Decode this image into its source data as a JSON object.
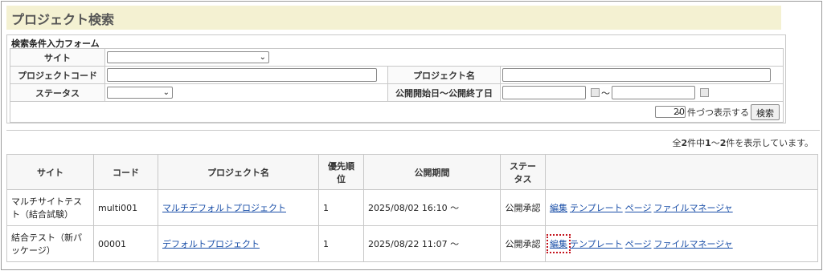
{
  "page_title": "プロジェクト検索",
  "form": {
    "caption": "検索条件入力フォーム",
    "site_label": "サイト",
    "site_value": "",
    "code_label": "プロジェクトコード",
    "code_value": "",
    "name_label": "プロジェクト名",
    "name_value": "",
    "status_label": "ステータス",
    "status_value": "",
    "period_label": "公開開始日～公開終了日",
    "period_start": "",
    "period_end": "",
    "tilde": "～",
    "per_page_value": "20",
    "per_page_label": "件づつ表示する",
    "search_button": "検索"
  },
  "count": {
    "prefix": "全",
    "total": "2",
    "mid1": "件中",
    "from": "1",
    "sep": "～",
    "to": "2",
    "suffix": "件を表示しています。"
  },
  "table": {
    "headers": [
      "サイト",
      "コード",
      "プロジェクト名",
      "優先順\n位",
      "公開期間",
      "ステー\nタス",
      ""
    ],
    "rows": [
      {
        "site": "マルチサイトテスト（結合試験）",
        "code": "multi001",
        "name": "マルチデフォルトプロジェクト",
        "priority": "1",
        "period": "2025/08/02 16:10 ～",
        "status": "公開承認",
        "actions": [
          "編集",
          "テンプレート",
          "ページ",
          "ファイルマネージャ"
        ]
      },
      {
        "site": "結合テスト（新パッケージ）",
        "code": "00001",
        "name": "デフォルトプロジェクト",
        "priority": "1",
        "period": "2025/08/22 11:07 ～",
        "status": "公開承認",
        "actions": [
          "編集",
          "テンプレート",
          "ページ",
          "ファイルマネージャ"
        ]
      }
    ]
  },
  "icons": {
    "dropdown": "chevron-down-icon",
    "calendar": "calendar-icon"
  },
  "colors": {
    "title_bg": "#f4f1d2",
    "link": "#1a4fa8",
    "highlight": "#c4131d"
  }
}
